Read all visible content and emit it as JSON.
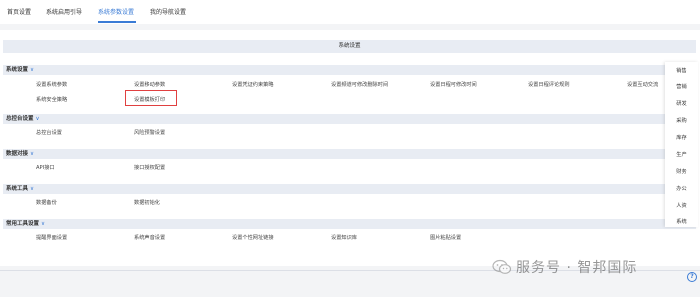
{
  "topnav": {
    "tabs": [
      {
        "label": "首页设置"
      },
      {
        "label": "系统启用引导"
      },
      {
        "label": "系统参数设置"
      },
      {
        "label": "我的导航设置"
      }
    ],
    "active_index": 2
  },
  "main": {
    "title": "系统设置",
    "sections": [
      {
        "title": "系统设置",
        "rows": [
          [
            "设置系统参数",
            "设置移动参数",
            "设置凭证约束策略",
            "设置频道可修改删除时间",
            "设置日程可修改时间",
            "设置日程评论规则",
            "设置互动交流"
          ],
          [
            "系统安全策略",
            "设置模板打印"
          ]
        ]
      },
      {
        "title": "总控台设置",
        "rows": [
          [
            "总控台设置",
            "风险预警设置"
          ]
        ]
      },
      {
        "title": "数据对接",
        "rows": [
          [
            "API接口",
            "接口授权配置"
          ]
        ]
      },
      {
        "title": "系统工具",
        "rows": [
          [
            "数据备份",
            "数据初始化"
          ]
        ]
      },
      {
        "title": "常用工具设置",
        "rows": [
          [
            "提醒界面设置",
            "系统声音设置",
            "设置个性网址链接",
            "设置知识库",
            "图片粘贴设置"
          ]
        ]
      }
    ],
    "highlighted_item": "设置模板打印"
  },
  "sidemenu": {
    "items": [
      "销售",
      "营销",
      "研发",
      "采购",
      "库存",
      "生产",
      "财务",
      "办公",
      "人资",
      "系统"
    ]
  },
  "watermark": {
    "text": "服务号 · 智邦国际"
  },
  "help_icon_glyph": "?"
}
